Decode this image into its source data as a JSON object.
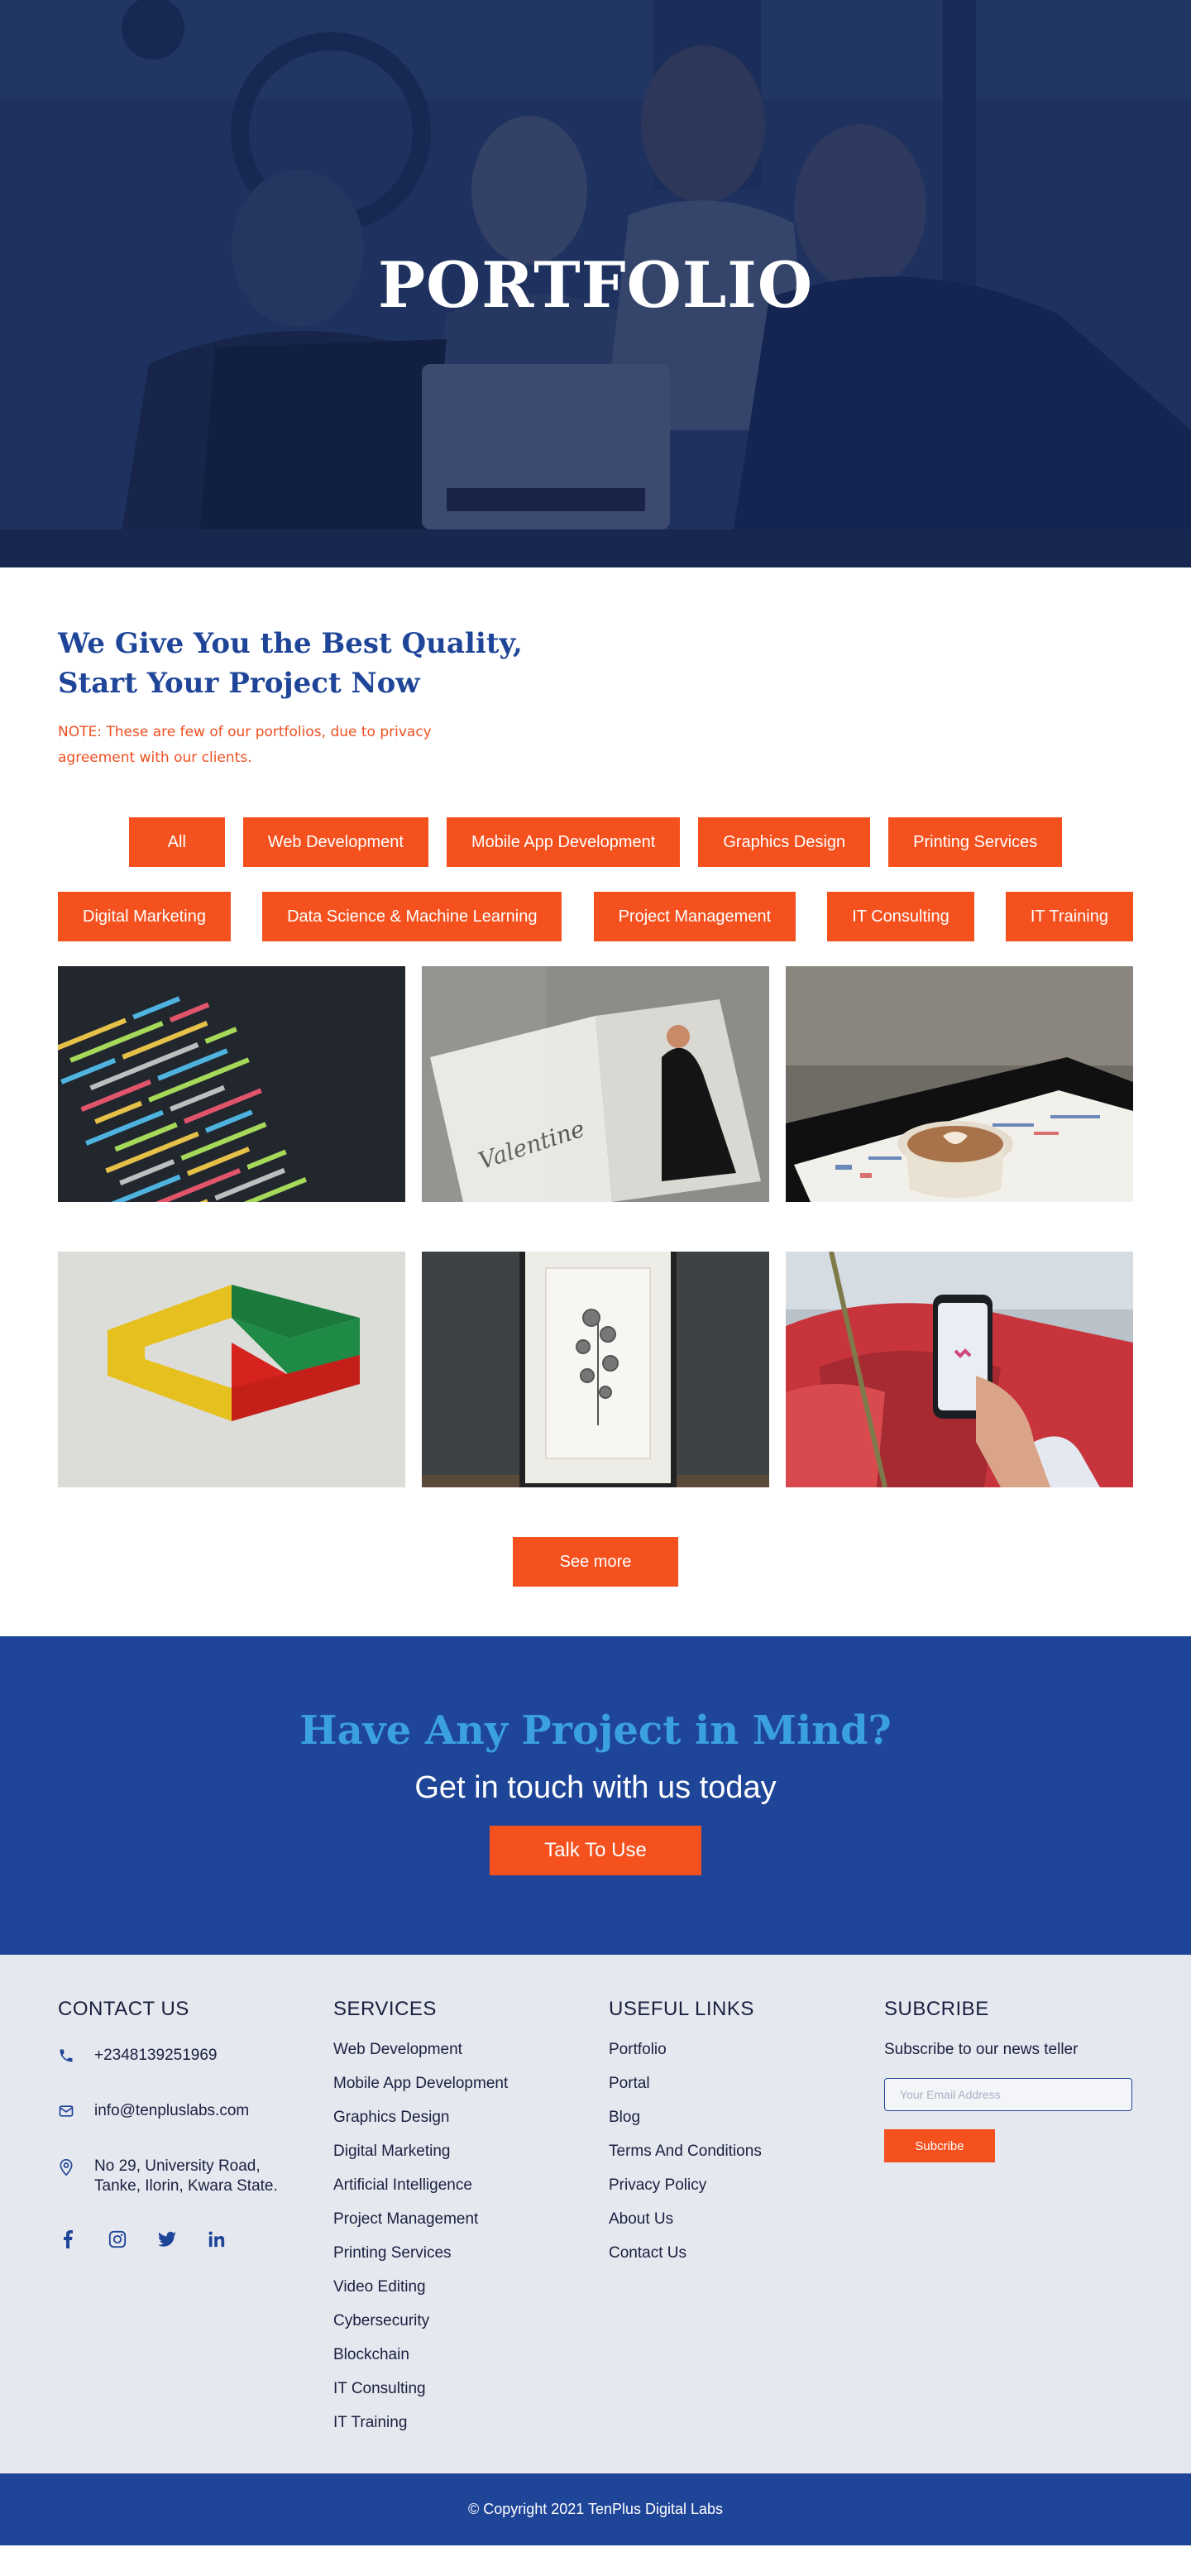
{
  "hero": {
    "title": "PORTFOLIO"
  },
  "intro": {
    "heading": "We Give You the Best Quality, Start Your Project Now",
    "note": "NOTE: These are few of our portfolios, due to privacy agreement with our clients."
  },
  "filters": {
    "row1": [
      "All",
      "Web Development",
      "Mobile App Development",
      "Graphics Design",
      "Printing Services"
    ],
    "row2": [
      "Digital Marketing",
      "Data Science & Machine Learning",
      "Project Management",
      "IT Consulting",
      "IT Training"
    ]
  },
  "gallery": {
    "tiles": [
      "code-screen",
      "magazine-valentine",
      "coffee-menu",
      "3d-shape-logo",
      "framed-flower-art",
      "phone-in-hand"
    ]
  },
  "see_more": "See more",
  "cta": {
    "heading": "Have Any Project in Mind?",
    "subheading": "Get in touch with us today",
    "button": "Talk To Use"
  },
  "footer": {
    "contact": {
      "title": "CONTACT US",
      "phone": "+2348139251969",
      "email": "info@tenpluslabs.com",
      "address": "No 29, University Road, Tanke, Ilorin, Kwara State.",
      "socials": [
        "facebook-icon",
        "instagram-icon",
        "twitter-icon",
        "linkedin-icon"
      ]
    },
    "services": {
      "title": "SERVICES",
      "items": [
        "Web Development",
        "Mobile App Development",
        "Graphics Design",
        "Digital Marketing",
        "Artificial Intelligence",
        "Project Management",
        "Printing Services",
        "Video Editing",
        "Cybersecurity",
        "Blockchain",
        "IT Consulting",
        "IT Training"
      ]
    },
    "links": {
      "title": "USEFUL LINKS",
      "items": [
        "Portfolio",
        "Portal",
        "Blog",
        "Terms And Conditions",
        "Privacy Policy",
        "About Us",
        "Contact Us"
      ]
    },
    "subscribe": {
      "title": "SUBCRIBE",
      "text": "Subscribe to our news teller",
      "placeholder": "Your Email Address",
      "button": "Subcribe"
    }
  },
  "copyright": "© Copyright 2021 TenPlus Digital Labs",
  "colors": {
    "primary_blue": "#1f4599",
    "accent_orange": "#f4511e",
    "cta_heading": "#3aa0e0",
    "footer_bg": "#e5e8ee"
  }
}
